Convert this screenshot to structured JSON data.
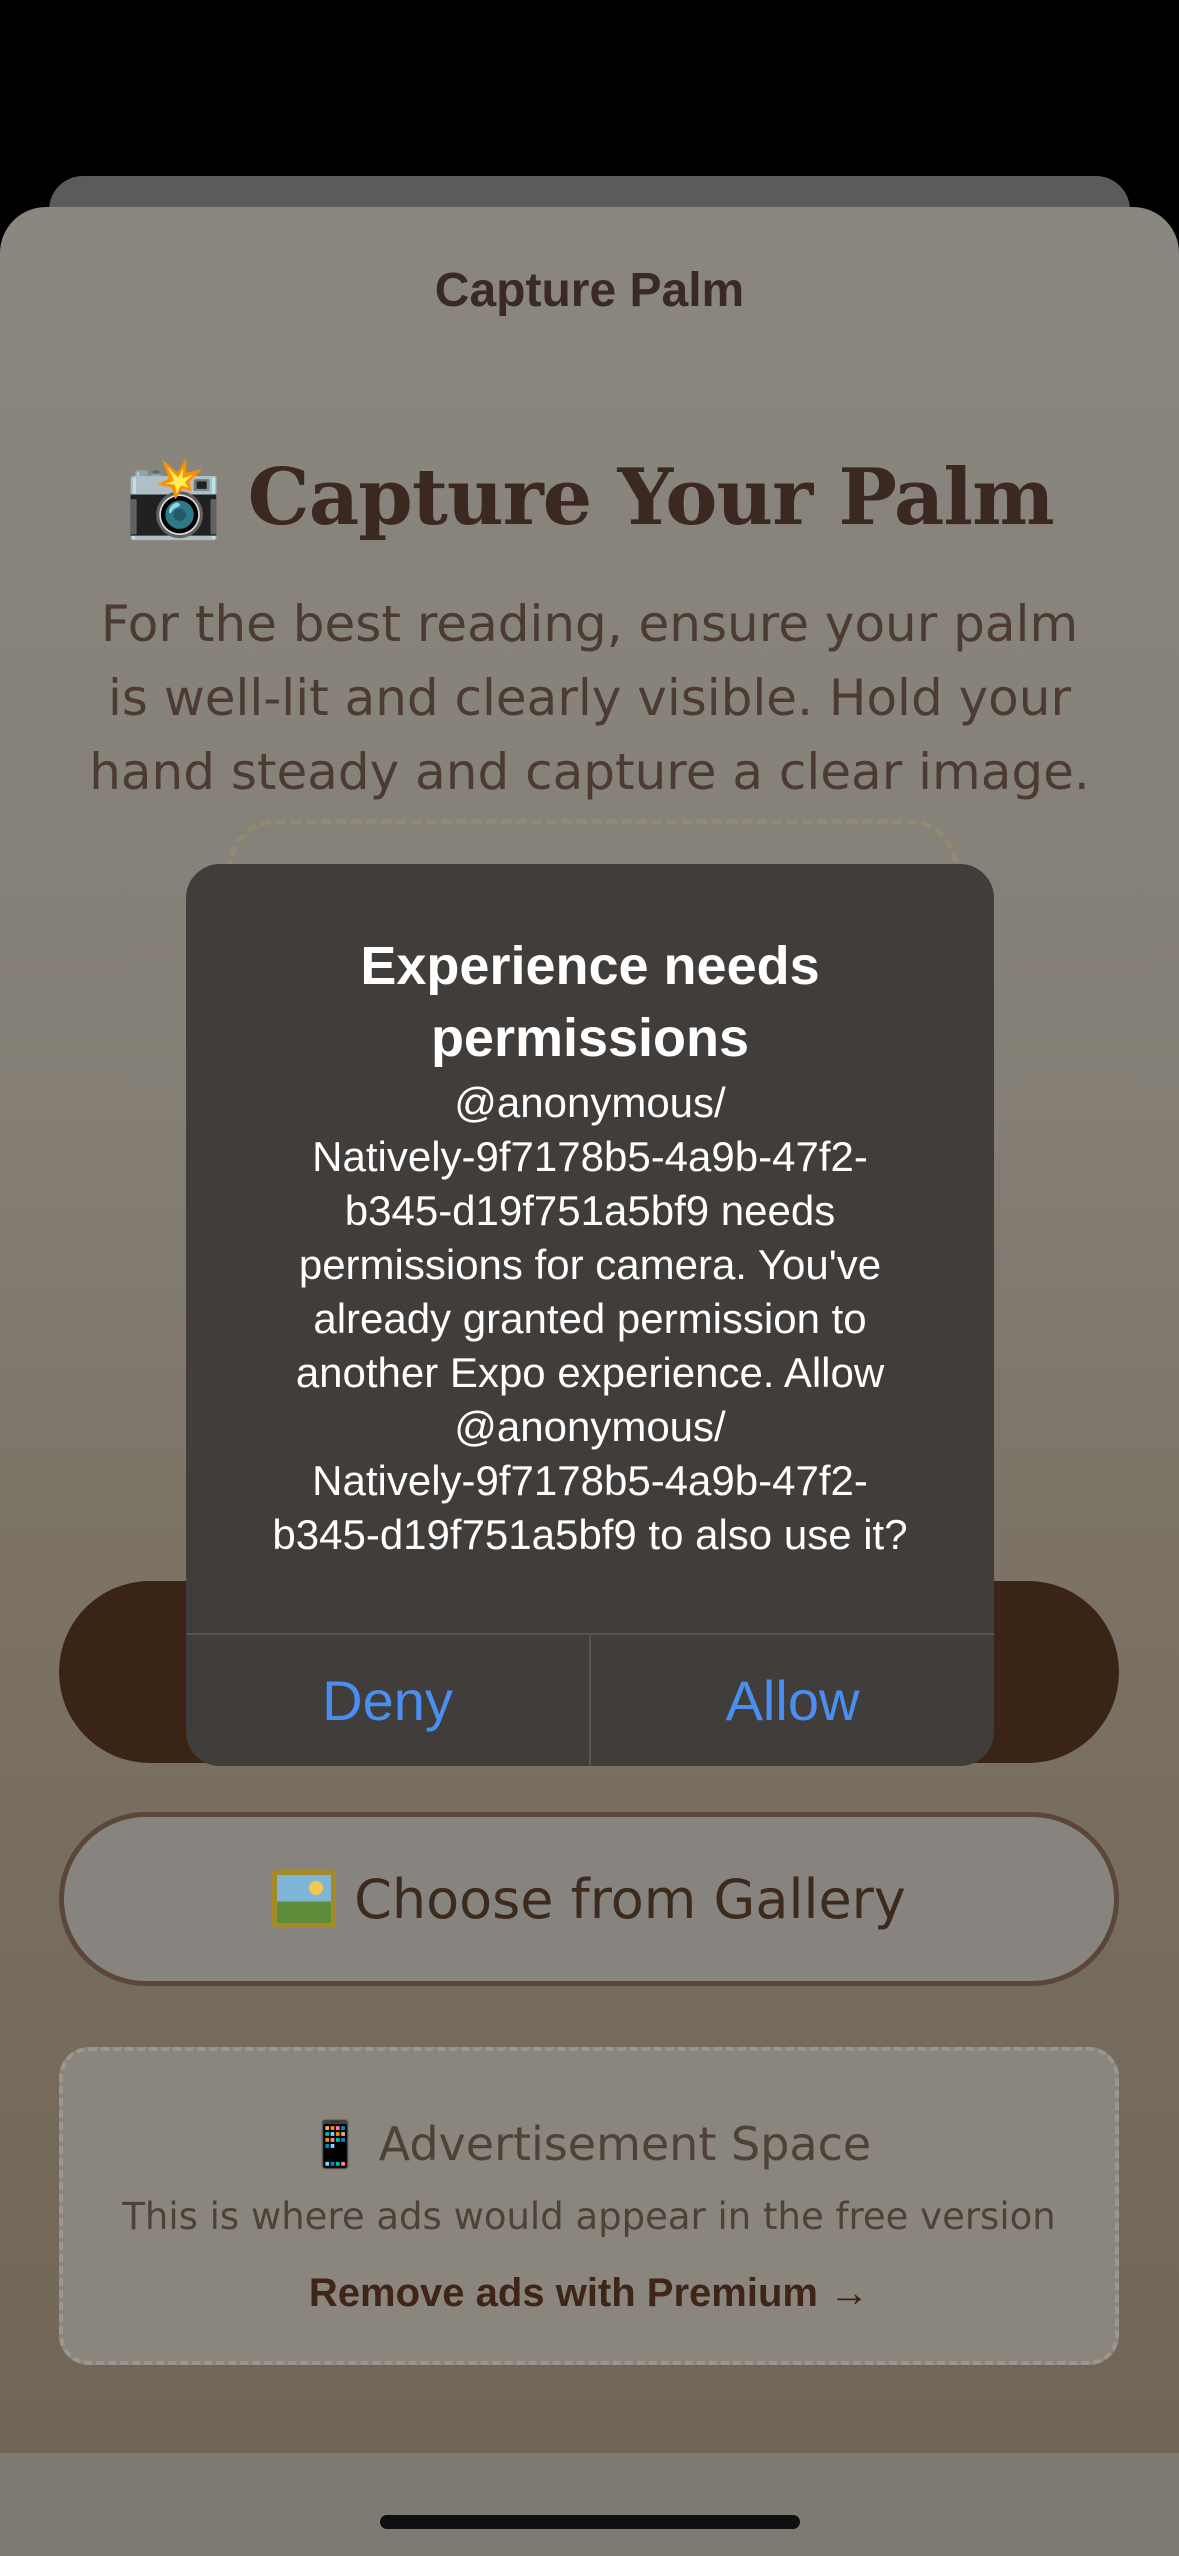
{
  "sheet": {
    "title": "Capture Palm"
  },
  "hero": {
    "emoji": "📸",
    "title": "Capture Your Palm",
    "description": "For the best reading, ensure your palm is well-lit and clearly visible. Hold your hand steady and capture a clear image."
  },
  "actions": {
    "gallery_label": "Choose from Gallery",
    "gallery_icon": "framed-picture-icon"
  },
  "ad": {
    "title": "📱 Advertisement Space",
    "subtitle": "This is where ads would appear in the free version",
    "link": "Remove ads with Premium →"
  },
  "alert": {
    "title": "Experience needs permissions",
    "message": "@anonymous/\nNatively-9f7178b5-4a9b-47f2-\nb345-d19f751a5bf9 needs\npermissions for camera. You've\nalready granted permission to\nanother Expo experience. Allow\n@anonymous/\nNatively-9f7178b5-4a9b-47f2-\nb345-d19f751a5bf9 to also use it?",
    "deny_label": "Deny",
    "allow_label": "Allow"
  },
  "colors": {
    "accent_blue": "#4a8ff0",
    "brown_primary": "#3a2416",
    "alert_bg": "#403d3a"
  }
}
